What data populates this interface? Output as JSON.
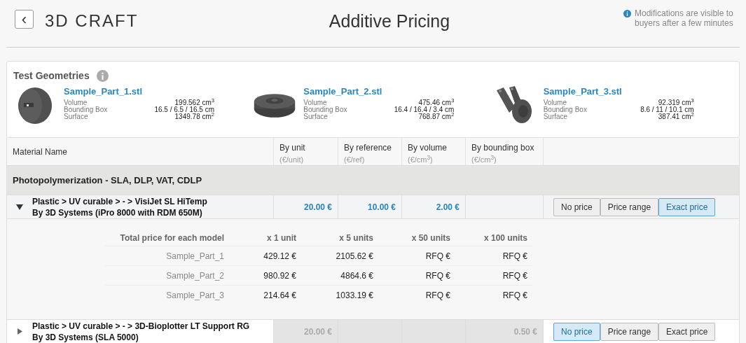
{
  "header": {
    "back": "‹",
    "brand": "3D CRAFT",
    "title": "Additive Pricing",
    "notice": "Modifications are visible to buyers after a few minutes"
  },
  "geometries": {
    "title": "Test Geometries",
    "parts": [
      {
        "name": "Sample_Part_1.stl",
        "specs": [
          {
            "label": "Volume",
            "value": "199.562 cm$^{3}$"
          },
          {
            "label": "Bounding Box",
            "value": "16.5 / 6.5 / 16.5 cm"
          },
          {
            "label": "Surface",
            "value": "1349.78 cm$^{2}$"
          }
        ]
      },
      {
        "name": "Sample_Part_2.stl",
        "specs": [
          {
            "label": "Volume",
            "value": "475.46 cm$^{3}$"
          },
          {
            "label": "Bounding Box",
            "value": "16.4 / 16.4 / 3.4 cm"
          },
          {
            "label": "Surface",
            "value": "768.87 cm$^{2}$"
          }
        ]
      },
      {
        "name": "Sample_Part_3.stl",
        "specs": [
          {
            "label": "Volume",
            "value": "92.319 cm$^{3}$"
          },
          {
            "label": "Bounding Box",
            "value": "8.6 / 11 / 10.1 cm"
          },
          {
            "label": "Surface",
            "value": "387.41 cm$^{2}$"
          }
        ]
      }
    ]
  },
  "table": {
    "columns": [
      {
        "label": "Material Name"
      },
      {
        "label": "By unit",
        "unit": "(€/unit)"
      },
      {
        "label": "By reference",
        "unit": "(€/ref)"
      },
      {
        "label": "By volume",
        "unit": "(€/cm$^{3}$)"
      },
      {
        "label": "By bounding box",
        "unit": "(€/cm$^{3}$)"
      }
    ],
    "group": "Photopolymerization - SLA, DLP, VAT, CDLP",
    "materials": [
      {
        "path": "Plastic > UV curable > - > VisiJet SL HiTemp",
        "maker": "By 3D Systems (iPro 8000 with RDM 650M)",
        "expanded": true,
        "disabled": false,
        "prices": {
          "by_unit": "20.00 €",
          "by_reference": "10.00 €",
          "by_volume": "2.00 €"
        },
        "modes": [
          {
            "label": "No price",
            "selected": false
          },
          {
            "label": "Price range",
            "selected": false
          },
          {
            "label": "Exact price",
            "selected": true
          }
        ],
        "detail": {
          "columns": [
            "Total price for each model",
            "x 1 unit",
            "x 5 units",
            "x 50 units",
            "x 100 units"
          ],
          "rows": [
            [
              "Sample_Part_1",
              "429.12 €",
              "2105.62 €",
              "RFQ €",
              "RFQ €"
            ],
            [
              "Sample_Part_2",
              "980.92 €",
              "4864.6 €",
              "RFQ €",
              "RFQ €"
            ],
            [
              "Sample_Part_3",
              "214.64 €",
              "1033.19 €",
              "RFQ €",
              "RFQ €"
            ]
          ]
        }
      },
      {
        "path": "Plastic > UV curable > - > 3D-Bioplotter LT Support RG",
        "maker": "By 3D Systems (SLA 5000)",
        "expanded": false,
        "disabled": true,
        "prices": {
          "by_unit": "20.00 €",
          "by_bounding_box": "0.50 €"
        },
        "modes": [
          {
            "label": "No price",
            "selected": true
          },
          {
            "label": "Price range",
            "selected": false
          },
          {
            "label": "Exact price",
            "selected": false
          }
        ]
      }
    ]
  }
}
